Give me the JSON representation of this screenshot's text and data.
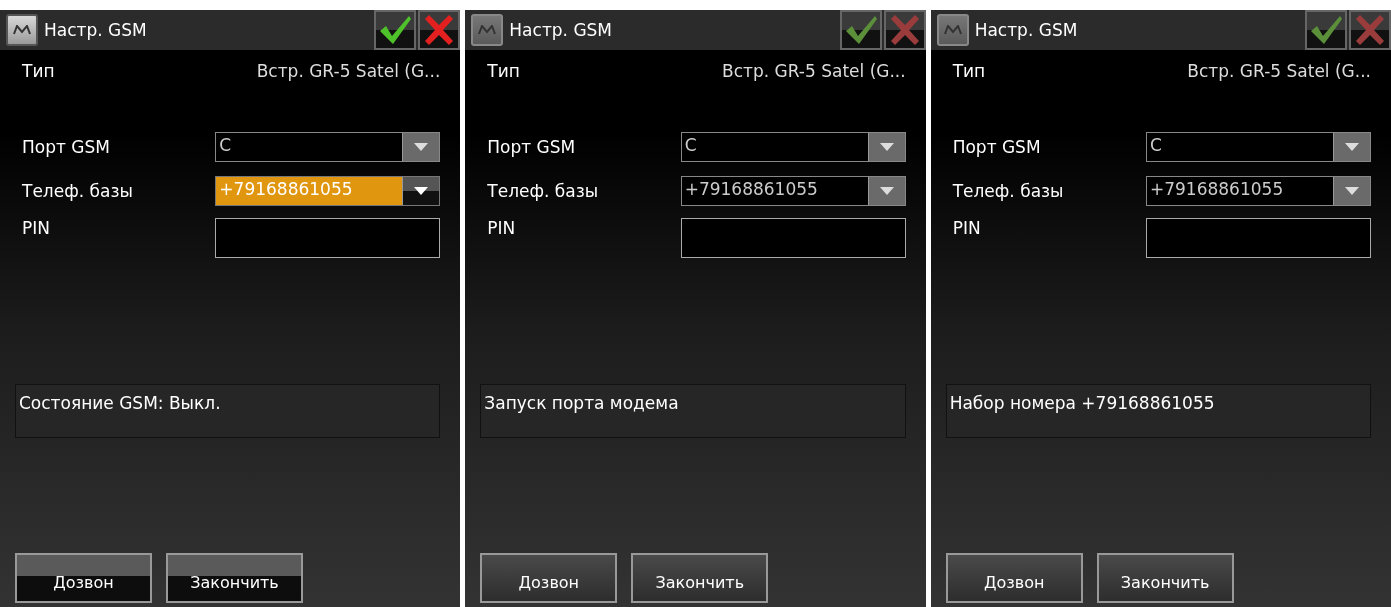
{
  "screens": [
    {
      "title": "Настр. GSM",
      "disabled": false,
      "type_label": "Тип",
      "type_value": "Встр. GR-5 Satel (G...",
      "fields": [
        {
          "kind": "dropdown",
          "label": "Порт GSM",
          "value": "C",
          "focused": false
        },
        {
          "kind": "dropdown",
          "label": "Телеф. базы",
          "value": "+79168861055",
          "focused": true
        },
        {
          "kind": "text",
          "label": "PIN",
          "focused": false
        }
      ],
      "status": "Состояние GSM: Выкл.",
      "buttons": [
        "Дозвон",
        "Закончить"
      ]
    },
    {
      "title": "Настр. GSM",
      "disabled": true,
      "type_label": "Тип",
      "type_value": "Встр. GR-5 Satel (G...",
      "fields": [
        {
          "kind": "dropdown",
          "label": "Порт GSM",
          "value": "C",
          "focused": false
        },
        {
          "kind": "dropdown",
          "label": "Телеф. базы",
          "value": "+79168861055",
          "focused": false
        },
        {
          "kind": "text",
          "label": "PIN",
          "focused": false
        }
      ],
      "status": "Запуск порта модема",
      "buttons": [
        "Дозвон",
        "Закончить"
      ]
    },
    {
      "title": "Настр. GSM",
      "disabled": true,
      "type_label": "Тип",
      "type_value": "Встр. GR-5 Satel (G...",
      "fields": [
        {
          "kind": "dropdown",
          "label": "Порт GSM",
          "value": "C",
          "focused": false
        },
        {
          "kind": "dropdown",
          "label": "Телеф. базы",
          "value": "+79168861055",
          "focused": false
        },
        {
          "kind": "text",
          "label": "PIN",
          "focused": false
        }
      ],
      "status": "Набор номера +79168861055",
      "buttons": [
        "Дозвон",
        "Закончить"
      ]
    }
  ]
}
